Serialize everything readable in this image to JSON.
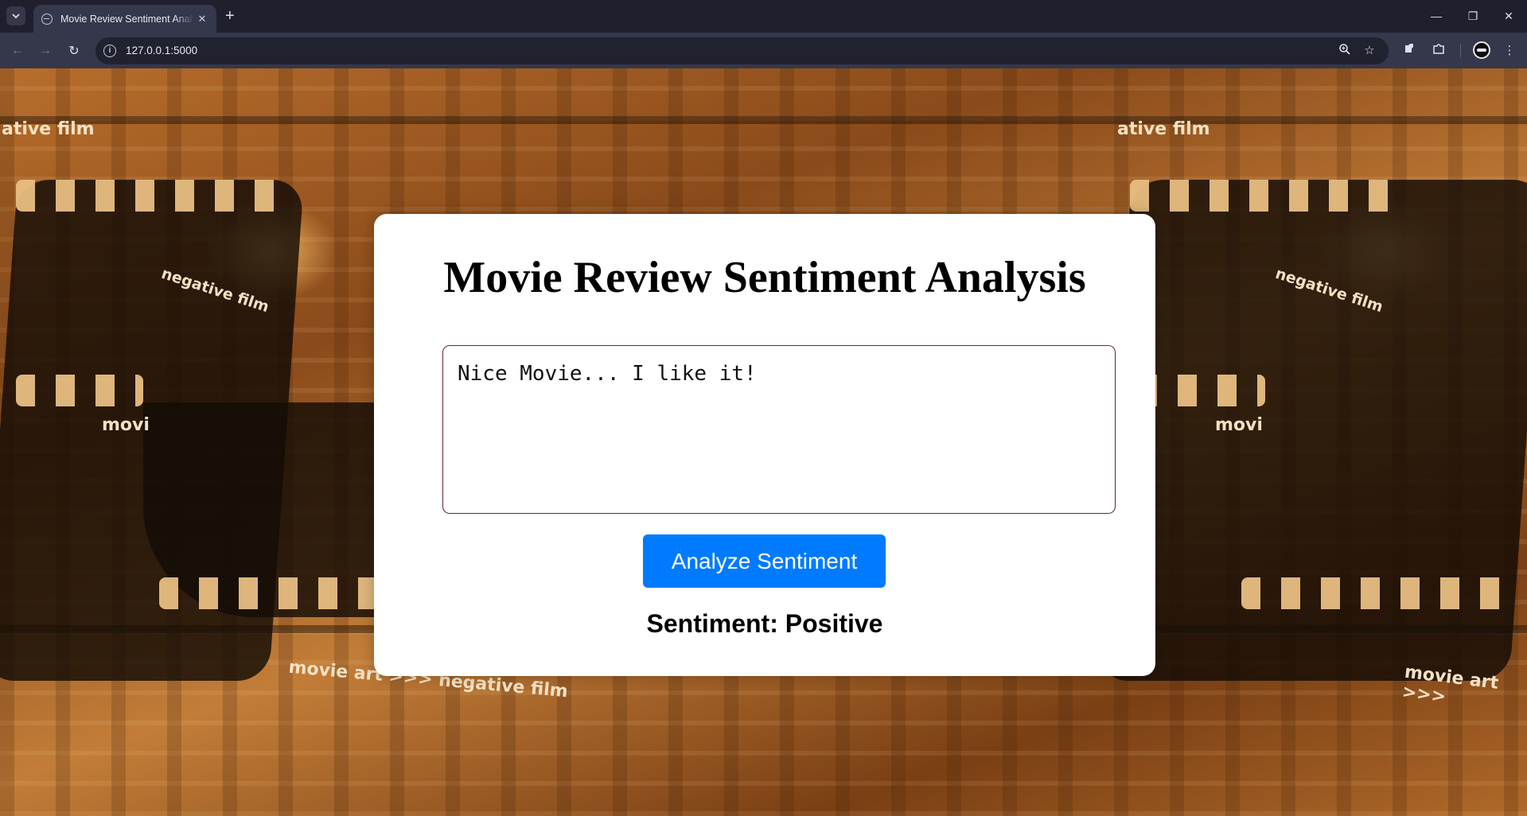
{
  "browser": {
    "tab_title": "Movie Review Sentiment Analysis",
    "url": "127.0.0.1:5000"
  },
  "background": {
    "strip_texts": [
      "ative film",
      "ative film",
      "negative film",
      "negative film",
      "movi",
      "movi",
      "movie art >>> negative film",
      "movie art >>>"
    ]
  },
  "page": {
    "title": "Movie Review Sentiment Analysis",
    "review_value": "Nice Movie... I like it!",
    "analyze_label": "Analyze Sentiment",
    "result_text": "Sentiment: Positive"
  },
  "colors": {
    "accent_button": "#007bff",
    "card_background": "#ffffff"
  },
  "icons": [
    "tab-search-icon",
    "globe-icon",
    "close-icon",
    "plus-icon",
    "minimize-icon",
    "restore-icon",
    "back-icon",
    "forward-icon",
    "reload-icon",
    "site-info-icon",
    "zoom-icon",
    "star-icon",
    "extension-puzzle-icon",
    "menu-dots-icon"
  ]
}
